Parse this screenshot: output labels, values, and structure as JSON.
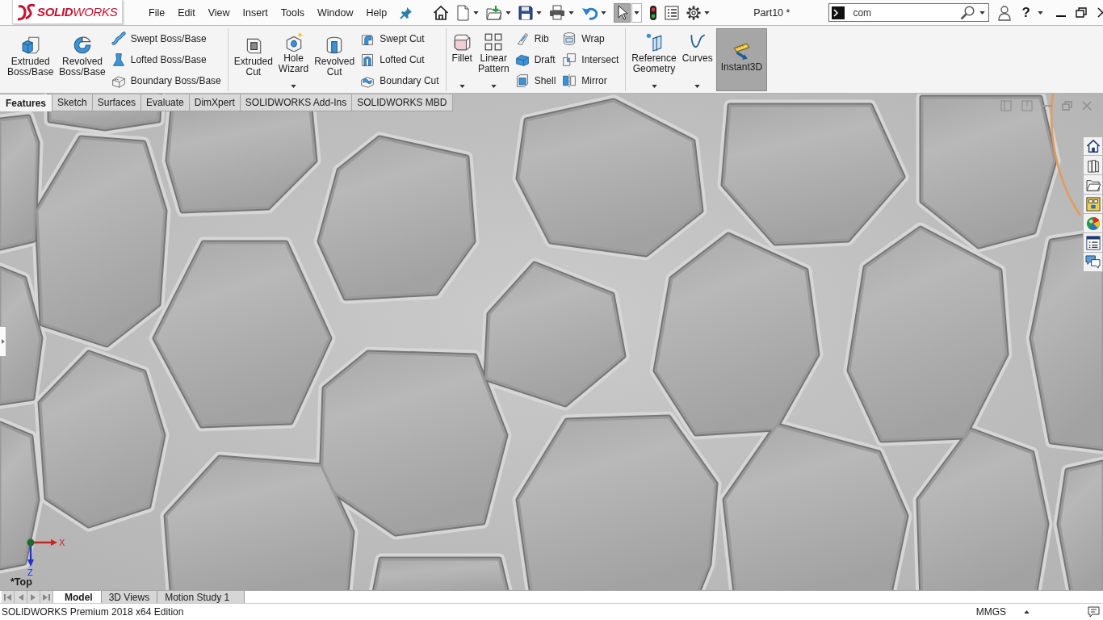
{
  "title_bar": {
    "logo": "**SOLID**WORKS",
    "menu": [
      "File",
      "Edit",
      "View",
      "Insert",
      "Tools",
      "Window",
      "Help"
    ],
    "select_tool": {
      "pressed": true
    },
    "document_title": "Part10 *",
    "search": {
      "value": "com"
    },
    "help": "?"
  },
  "ribbon": {
    "groups": [
      {
        "items": [
          {
            "kind": "large",
            "label": "Extruded Boss/Base",
            "dropdown": false,
            "pressed": false
          },
          {
            "kind": "large",
            "label": "Revolved Boss/Base",
            "dropdown": false,
            "pressed": false
          },
          {
            "kind": "column",
            "buttons": [
              {
                "label": "Swept Boss/Base"
              },
              {
                "label": "Lofted Boss/Base"
              },
              {
                "label": "Boundary Boss/Base"
              }
            ]
          }
        ]
      },
      {
        "items": [
          {
            "kind": "large",
            "label": "Extruded Cut",
            "dropdown": false,
            "pressed": false
          },
          {
            "kind": "large",
            "label": "Hole Wizard",
            "dropdown": true,
            "pressed": false
          },
          {
            "kind": "large",
            "label": "Revolved Cut",
            "dropdown": false,
            "pressed": false
          },
          {
            "kind": "column",
            "buttons": [
              {
                "label": "Swept Cut"
              },
              {
                "label": "Lofted Cut"
              },
              {
                "label": "Boundary Cut"
              }
            ]
          }
        ]
      },
      {
        "items": [
          {
            "kind": "large",
            "label": "Fillet",
            "dropdown": true,
            "pressed": false
          },
          {
            "kind": "large",
            "label": "Linear Pattern",
            "dropdown": true,
            "pressed": false
          },
          {
            "kind": "column",
            "buttons": [
              {
                "label": "Rib"
              },
              {
                "label": "Draft"
              },
              {
                "label": "Shell"
              }
            ]
          },
          {
            "kind": "column",
            "buttons": [
              {
                "label": "Wrap"
              },
              {
                "label": "Intersect"
              },
              {
                "label": "Mirror"
              }
            ]
          }
        ]
      },
      {
        "items": [
          {
            "kind": "large",
            "label": "Reference Geometry",
            "dropdown": true,
            "pressed": false
          },
          {
            "kind": "large",
            "label": "Curves",
            "dropdown": true,
            "pressed": false
          },
          {
            "kind": "large",
            "label": "Instant3D",
            "dropdown": false,
            "pressed": true
          }
        ]
      }
    ]
  },
  "command_tabs": [
    {
      "label": "Features",
      "selected": true
    },
    {
      "label": "Sketch",
      "selected": false
    },
    {
      "label": "Surfaces",
      "selected": false
    },
    {
      "label": "Evaluate",
      "selected": false
    },
    {
      "label": "DimXpert",
      "selected": false
    },
    {
      "label": "SOLIDWORKS Add-Ins",
      "selected": false
    },
    {
      "label": "SOLIDWORKS MBD",
      "selected": false
    }
  ],
  "viewport": {
    "view_name": "*Top",
    "axes": [
      {
        "kind": "x",
        "label": "X"
      },
      {
        "kind": "z",
        "label": "Z"
      }
    ]
  },
  "bottom_tabs": [
    {
      "label": "Model",
      "selected": true
    },
    {
      "label": "3D Views",
      "selected": false
    },
    {
      "label": "Motion Study 1",
      "selected": false
    }
  ],
  "status_bar": {
    "edition": "SOLIDWORKS Premium 2018 x64 Edition",
    "units": "MMGS"
  }
}
